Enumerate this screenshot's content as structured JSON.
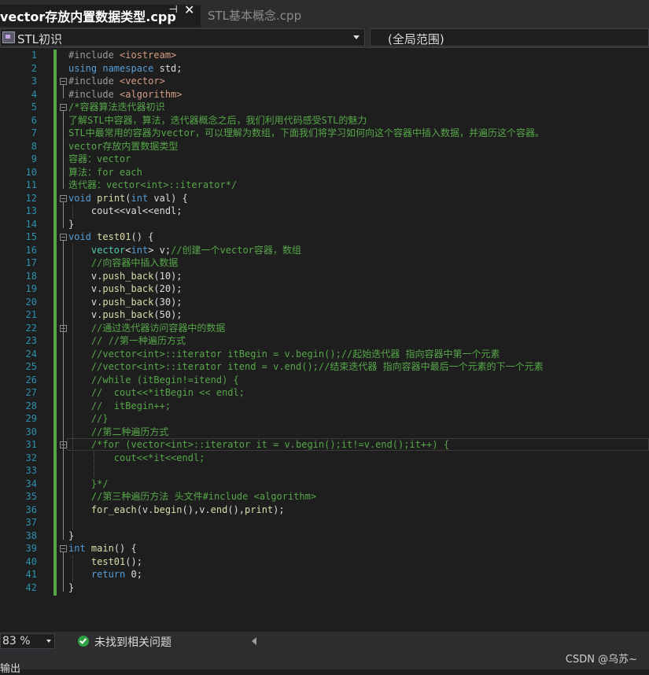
{
  "tabs": {
    "active_title": "vector存放内置数据类型.cpp",
    "pin_icon": "pin-icon",
    "close_icon": "close-icon",
    "inactive_title": "STL基本概念.cpp"
  },
  "navbar": {
    "project": "STL初识",
    "scope": "(全局范围)"
  },
  "code_lines": [
    {
      "n": "1",
      "html": "<span class='pp'>#include</span> <span class='str'>&lt;iostream&gt;</span>"
    },
    {
      "n": "2",
      "html": "<span class='kw'>using namespace</span> std;"
    },
    {
      "n": "3",
      "html": "<span class='pp'>#include</span> <span class='str'>&lt;vector&gt;</span>"
    },
    {
      "n": "4",
      "html": "<span class='pp'>#include</span> <span class='str'>&lt;algorithm&gt;</span>"
    },
    {
      "n": "5",
      "html": "<span class='cm'>/*容器算法迭代器初识</span>"
    },
    {
      "n": "6",
      "html": "<span class='cm'>了解STL中容器，算法，迭代器概念之后，我们利用代码感受STL的魅力</span>"
    },
    {
      "n": "7",
      "html": "<span class='cm'>STL中最常用的容器为vector，可以理解为数组，下面我们将学习如何向这个容器中插入数据，并遍历这个容器。</span>"
    },
    {
      "n": "8",
      "html": "<span class='cm'>vector存放内置数据类型</span>"
    },
    {
      "n": "9",
      "html": "<span class='cm'>容器：vector</span>"
    },
    {
      "n": "10",
      "html": "<span class='cm'>算法：for each</span>"
    },
    {
      "n": "11",
      "html": "<span class='cm'>迭代器：vector&lt;int&gt;::iterator*/</span>"
    },
    {
      "n": "12",
      "html": "<span class='kw'>void</span> <span class='fn'>print</span>(<span class='kw'>int</span> val) {"
    },
    {
      "n": "13",
      "html": "    cout&lt;&lt;val&lt;&lt;endl;"
    },
    {
      "n": "14",
      "html": "}"
    },
    {
      "n": "15",
      "html": "<span class='kw'>void</span> <span class='fn'>test01</span>() {"
    },
    {
      "n": "16",
      "html": "    <span class='ty'>vector</span>&lt;<span class='kw'>int</span>&gt; v;<span class='cm'>//创建一个vector容器，数组</span>"
    },
    {
      "n": "17",
      "html": "    <span class='cm'>//向容器中插入数据</span>"
    },
    {
      "n": "18",
      "html": "    v.<span class='fn'>push_back</span>(10);"
    },
    {
      "n": "19",
      "html": "    v.<span class='fn'>push_back</span>(20);"
    },
    {
      "n": "20",
      "html": "    v.<span class='fn'>push_back</span>(30);"
    },
    {
      "n": "21",
      "html": "    v.<span class='fn'>push_back</span>(50);"
    },
    {
      "n": "22",
      "html": "    <span class='cm'>//通过迭代器访问容器中的数据</span>"
    },
    {
      "n": "23",
      "html": "    <span class='cm'>// //第一种遍历方式</span>"
    },
    {
      "n": "24",
      "html": "    <span class='cm'>//vector&lt;int&gt;::iterator itBegin = v.begin();//起始迭代器 指向容器中第一个元素</span>"
    },
    {
      "n": "25",
      "html": "    <span class='cm'>//vector&lt;int&gt;::iterator itend = v.end();//结束迭代器 指向容器中最后一个元素的下一个元素</span>"
    },
    {
      "n": "26",
      "html": "    <span class='cm'>//while (itBegin!=itend) {</span>"
    },
    {
      "n": "27",
      "html": "    <span class='cm'>//  cout&lt;&lt;*itBegin &lt;&lt; endl;</span>"
    },
    {
      "n": "28",
      "html": "    <span class='cm'>//  itBegin++;</span>"
    },
    {
      "n": "29",
      "html": "    <span class='cm'>//}</span>"
    },
    {
      "n": "30",
      "html": "    <span class='cm'>//第二种遍历方式</span>"
    },
    {
      "n": "31",
      "html": "    <span class='cm'>/*for (vector&lt;int&gt;::iterator it = v.begin();it!=v.end();it++) {</span>"
    },
    {
      "n": "32",
      "html": "    <span class='cm'>    cout&lt;&lt;*it&lt;&lt;endl;</span>"
    },
    {
      "n": "33",
      "html": ""
    },
    {
      "n": "34",
      "html": "    <span class='cm'>}*/</span>"
    },
    {
      "n": "35",
      "html": "    <span class='cm'>//第三种遍历方法 头文件#include &lt;algorithm&gt;</span>"
    },
    {
      "n": "36",
      "html": "    <span class='fn'>for_each</span>(v.<span class='fn'>begin</span>(),v.<span class='fn'>end</span>(),<span class='fn'>print</span>);"
    },
    {
      "n": "37",
      "html": ""
    },
    {
      "n": "38",
      "html": "}"
    },
    {
      "n": "39",
      "html": "<span class='kw'>int</span> <span class='fn'>main</span>() {"
    },
    {
      "n": "40",
      "html": "    <span class='fn'>test01</span>();"
    },
    {
      "n": "41",
      "html": "    <span class='kw'>return</span> 0;"
    },
    {
      "n": "42",
      "html": "}"
    }
  ],
  "status": {
    "zoom": "83 %",
    "issues_text": "未找到相关问题",
    "issues_icon": "check-circle-icon"
  },
  "bottom": {
    "output_label": "输出",
    "watermark": "CSDN @乌苏~"
  },
  "colors": {
    "background": "#1e1e1e",
    "keyword": "#569cd6",
    "comment": "#57a64a",
    "string": "#d69d85",
    "line_number": "#2b91af",
    "change_bar": "#57a64a"
  }
}
